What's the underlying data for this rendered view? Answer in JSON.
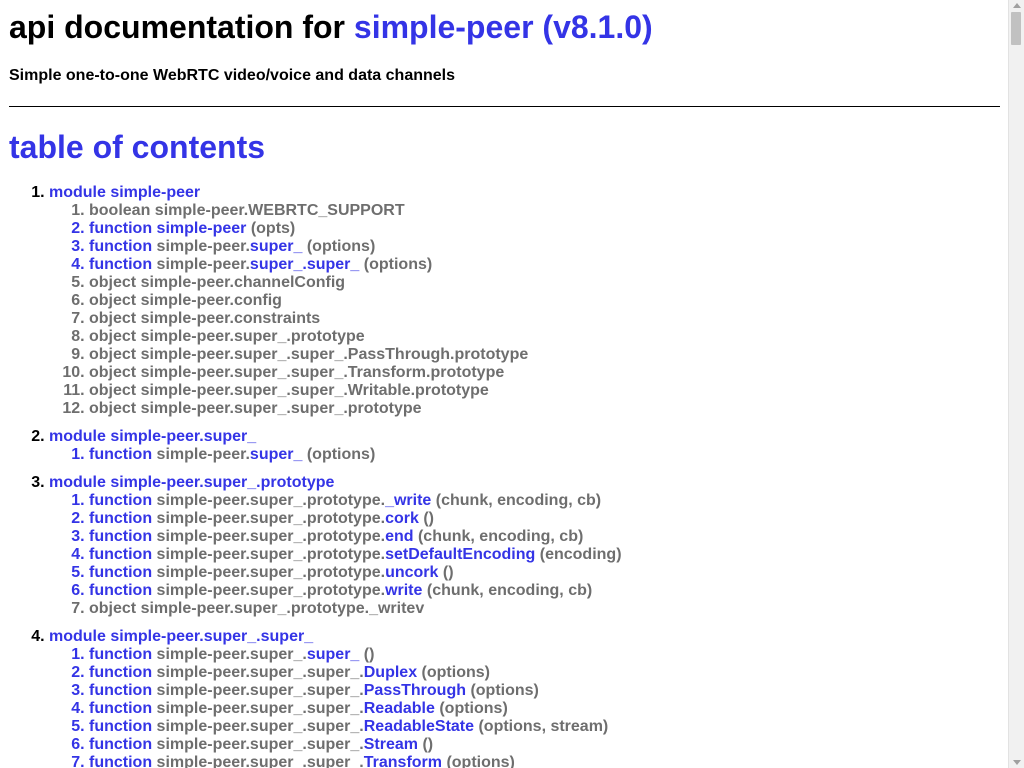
{
  "header": {
    "title_prefix": "api documentation for ",
    "title_package": "simple-peer (v8.1.0)",
    "subtitle": "Simple one-to-one WebRTC video/voice and data channels"
  },
  "toc": {
    "heading": "table of contents",
    "modules": [
      {
        "label": "module simple-peer",
        "entries": [
          {
            "kind": "boolean",
            "prefix": "simple-peer.WEBRTC_SUPPORT",
            "name": "",
            "args": ""
          },
          {
            "kind": "function",
            "prefix": "",
            "name": "simple-peer",
            "args": "(opts)"
          },
          {
            "kind": "function",
            "prefix": "simple-peer.",
            "name": "super_",
            "args": "(options)"
          },
          {
            "kind": "function",
            "prefix": "simple-peer.",
            "name": "super_.super_",
            "args": "(options)"
          },
          {
            "kind": "object",
            "prefix": "simple-peer.channelConfig",
            "name": "",
            "args": ""
          },
          {
            "kind": "object",
            "prefix": "simple-peer.config",
            "name": "",
            "args": ""
          },
          {
            "kind": "object",
            "prefix": "simple-peer.constraints",
            "name": "",
            "args": ""
          },
          {
            "kind": "object",
            "prefix": "simple-peer.super_.prototype",
            "name": "",
            "args": ""
          },
          {
            "kind": "object",
            "prefix": "simple-peer.super_.super_.PassThrough.prototype",
            "name": "",
            "args": ""
          },
          {
            "kind": "object",
            "prefix": "simple-peer.super_.super_.Transform.prototype",
            "name": "",
            "args": ""
          },
          {
            "kind": "object",
            "prefix": "simple-peer.super_.super_.Writable.prototype",
            "name": "",
            "args": ""
          },
          {
            "kind": "object",
            "prefix": "simple-peer.super_.super_.prototype",
            "name": "",
            "args": ""
          }
        ]
      },
      {
        "label": "module simple-peer.super_",
        "entries": [
          {
            "kind": "function",
            "prefix": "simple-peer.",
            "name": "super_",
            "args": "(options)"
          }
        ]
      },
      {
        "label": "module simple-peer.super_.prototype",
        "entries": [
          {
            "kind": "function",
            "prefix": "simple-peer.super_.prototype.",
            "name": "_write",
            "args": "(chunk, encoding, cb)"
          },
          {
            "kind": "function",
            "prefix": "simple-peer.super_.prototype.",
            "name": "cork",
            "args": "()"
          },
          {
            "kind": "function",
            "prefix": "simple-peer.super_.prototype.",
            "name": "end",
            "args": "(chunk, encoding, cb)"
          },
          {
            "kind": "function",
            "prefix": "simple-peer.super_.prototype.",
            "name": "setDefaultEncoding",
            "args": "(encoding)"
          },
          {
            "kind": "function",
            "prefix": "simple-peer.super_.prototype.",
            "name": "uncork",
            "args": "()"
          },
          {
            "kind": "function",
            "prefix": "simple-peer.super_.prototype.",
            "name": "write",
            "args": "(chunk, encoding, cb)"
          },
          {
            "kind": "object",
            "prefix": "simple-peer.super_.prototype._writev",
            "name": "",
            "args": ""
          }
        ]
      },
      {
        "label": "module simple-peer.super_.super_",
        "entries": [
          {
            "kind": "function",
            "prefix": "simple-peer.super_.",
            "name": "super_",
            "args": "()"
          },
          {
            "kind": "function",
            "prefix": "simple-peer.super_.super_.",
            "name": "Duplex",
            "args": "(options)"
          },
          {
            "kind": "function",
            "prefix": "simple-peer.super_.super_.",
            "name": "PassThrough",
            "args": "(options)"
          },
          {
            "kind": "function",
            "prefix": "simple-peer.super_.super_.",
            "name": "Readable",
            "args": "(options)"
          },
          {
            "kind": "function",
            "prefix": "simple-peer.super_.super_.",
            "name": "ReadableState",
            "args": "(options, stream)"
          },
          {
            "kind": "function",
            "prefix": "simple-peer.super_.super_.",
            "name": "Stream",
            "args": "()"
          },
          {
            "kind": "function",
            "prefix": "simple-peer.super_.super_.",
            "name": "Transform",
            "args": "(options)"
          }
        ]
      }
    ]
  },
  "colors": {
    "link": "#3434e6",
    "muted": "#6e6e6e",
    "text": "#000000"
  }
}
